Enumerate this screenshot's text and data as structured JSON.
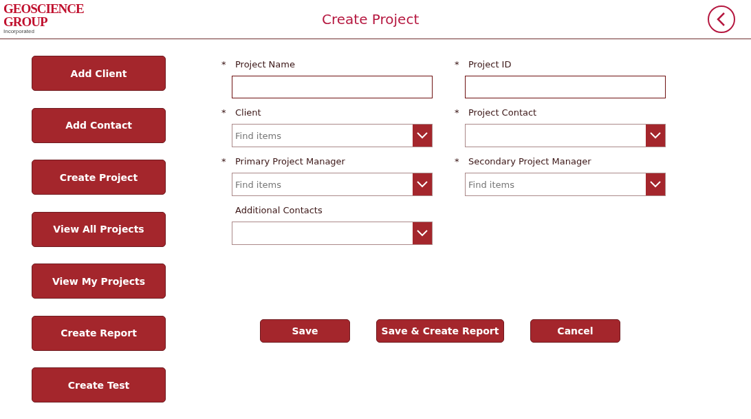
{
  "logo": {
    "line1": "GEOSCIENCE",
    "line2": "GROUP",
    "line3": "Incorporated"
  },
  "header": {
    "title": "Create Project"
  },
  "sidebar": {
    "items": [
      {
        "label": "Add Client"
      },
      {
        "label": "Add Contact"
      },
      {
        "label": "Create Project"
      },
      {
        "label": "View All Projects"
      },
      {
        "label": "View My Projects"
      },
      {
        "label": "Create Report"
      },
      {
        "label": "Create Test"
      }
    ]
  },
  "form": {
    "fields": [
      {
        "label": "Project Name",
        "marker": "*",
        "kind": "text"
      },
      {
        "label": "Project ID",
        "marker": "*",
        "kind": "text"
      },
      {
        "label": "Client",
        "marker": "*",
        "kind": "dropdown",
        "placeholder": "Find items"
      },
      {
        "label": "Project Contact",
        "marker": "*",
        "kind": "dropdown"
      },
      {
        "label": "Primary Project Manager",
        "marker": "*",
        "kind": "dropdown",
        "placeholder": "Find items"
      },
      {
        "label": "Secondary Project Manager",
        "marker": "*",
        "kind": "dropdown",
        "placeholder": "Find items"
      },
      {
        "label": "Additional Contacts",
        "kind": "dropdown"
      }
    ]
  },
  "actions": [
    "Save",
    "Save & Create Report",
    "Cancel"
  ]
}
